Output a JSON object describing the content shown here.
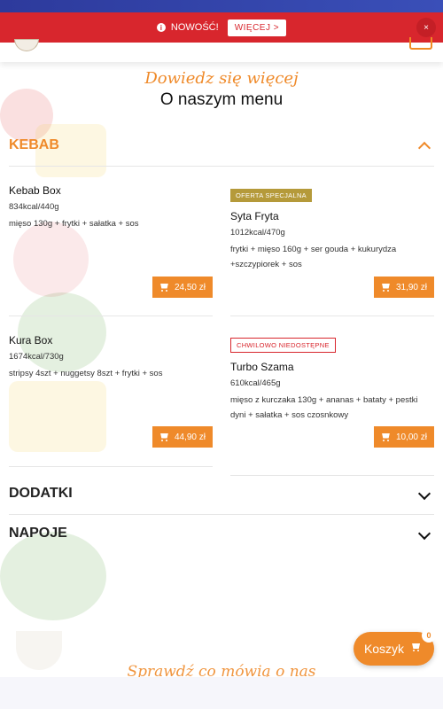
{
  "banner": {
    "text": "NOWOŚĆ!",
    "more_label": "WIĘCEJ >",
    "close_label": "×"
  },
  "intro": {
    "subtitle": "Dowiedz się więcej",
    "title": "O naszym menu"
  },
  "sections": {
    "kebab": "KEBAB",
    "addons": "DODATKI",
    "drinks": "NAPOJE"
  },
  "menu_items": [
    {
      "name": "Kebab Box",
      "kcal": "834kcal/440g",
      "desc": "mięso 130g + frytki + sałatka + sos",
      "price": "24,50 zł",
      "badge": ""
    },
    {
      "name": "Syta Fryta",
      "kcal": "1012kcal/470g",
      "desc": "frytki + mięso 160g + ser gouda + kukurydza +szczypiorek + sos",
      "price": "31,90 zł",
      "badge": "OFERTA SPECJALNA"
    },
    {
      "name": "Kura Box",
      "kcal": "1674kcal/730g",
      "desc": "stripsy 4szt + nuggetsy 8szt + frytki + sos",
      "price": "44,90 zł",
      "badge": ""
    },
    {
      "name": "Turbo Szama",
      "kcal": "610kcal/465g",
      "desc": "mięso z kurczaka 130g + ananas + bataty + pestki dyni + sałatka + sos czosnkowy",
      "price": "10,00 zł",
      "badge": "CHWILOWO NIEDOSTĘPNE"
    }
  ],
  "cart": {
    "label": "Koszyk",
    "count": "0"
  },
  "footer": {
    "teaser": "Sprawdź co mówią o nas"
  },
  "colors": {
    "accent": "#ef8a2a",
    "banner_red": "#d8262d",
    "top_blue": "#2d3a9c",
    "special_badge": "#b59a3a"
  },
  "icons": [
    "info-icon",
    "close-icon",
    "menu-icon",
    "chevron-up-icon",
    "chevron-down-icon",
    "cart-icon"
  ]
}
